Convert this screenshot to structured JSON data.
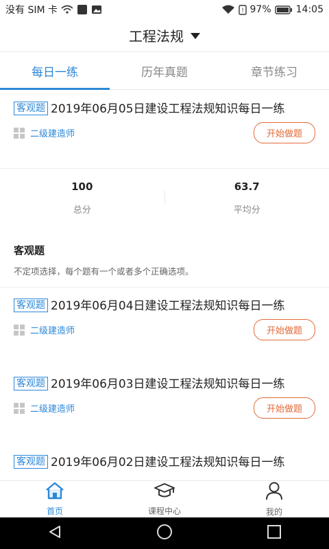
{
  "status_bar": {
    "carrier": "没有 SIM 卡",
    "battery": "97%",
    "time": "14:05"
  },
  "header": {
    "title": "工程法规"
  },
  "tabs": [
    {
      "label": "每日一练",
      "active": true
    },
    {
      "label": "历年真题",
      "active": false
    },
    {
      "label": "章节练习",
      "active": false
    }
  ],
  "items": [
    {
      "tag": "客观题",
      "title": "2019年06月05日建设工程法规知识每日一练",
      "category": "二级建造师",
      "button": "开始做题"
    },
    {
      "tag": "客观题",
      "title": "2019年06月04日建设工程法规知识每日一练",
      "category": "二级建造师",
      "button": "开始做题"
    },
    {
      "tag": "客观题",
      "title": "2019年06月03日建设工程法规知识每日一练",
      "category": "二级建造师",
      "button": "开始做题"
    },
    {
      "tag": "客观题",
      "title": "2019年06月02日建设工程法规知识每日一练"
    }
  ],
  "stats": {
    "total_value": "100",
    "total_label": "总分",
    "avg_value": "63.7",
    "avg_label": "平均分"
  },
  "question_type": {
    "title": "客观题",
    "description": "不定项选择，每个题有一个或者多个正确选项。"
  },
  "bottom_nav": [
    {
      "label": "首页",
      "icon": "home-icon",
      "active": true
    },
    {
      "label": "课程中心",
      "icon": "graduation-cap-icon",
      "active": false
    },
    {
      "label": "我的",
      "icon": "user-icon",
      "active": false
    }
  ],
  "colors": {
    "accent": "#2b87d8",
    "button": "#e36a38"
  }
}
